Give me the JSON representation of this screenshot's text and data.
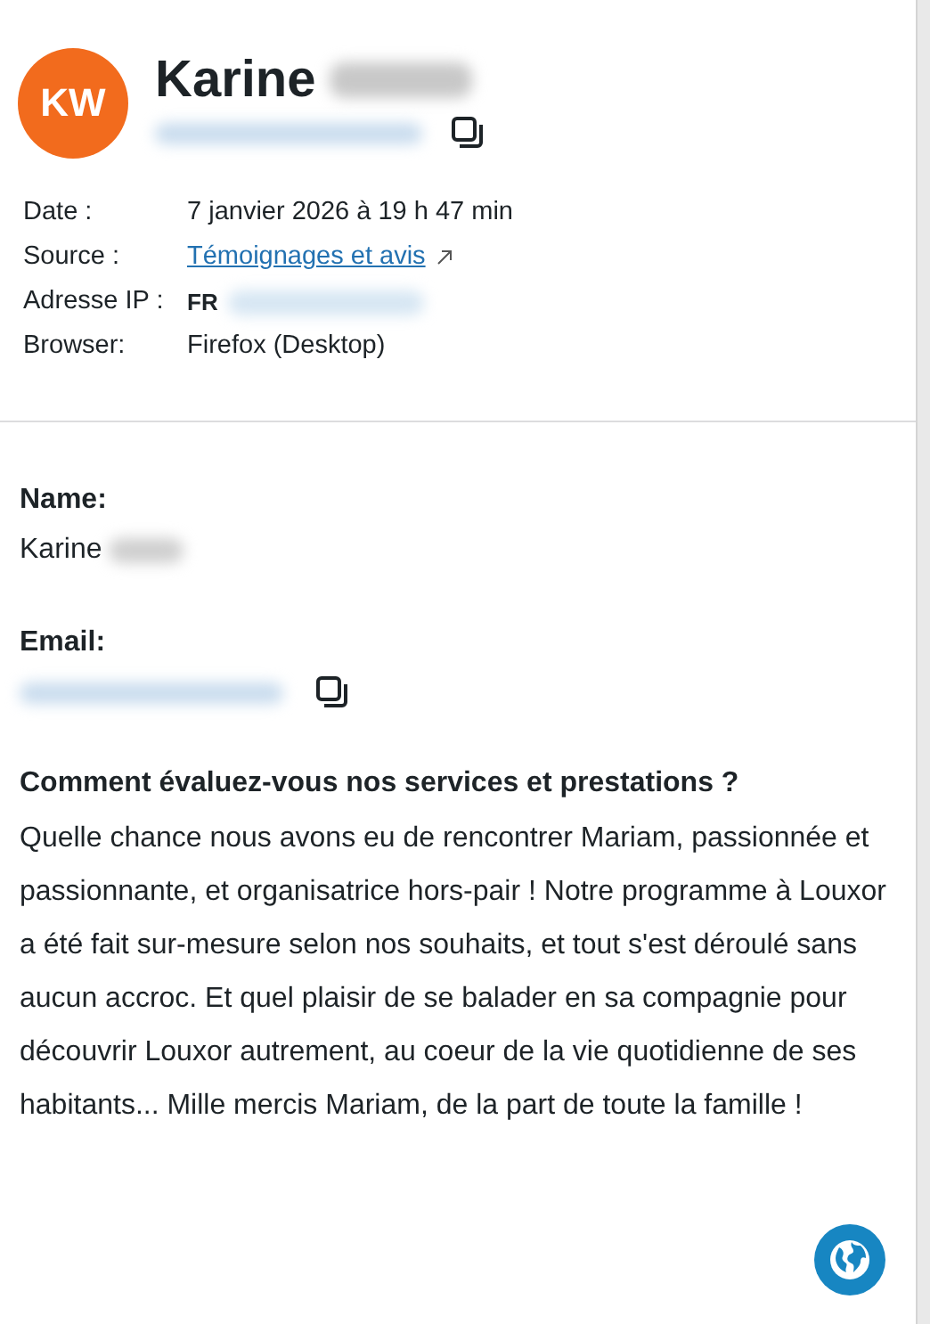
{
  "header": {
    "initials": "KW",
    "name": "Karine"
  },
  "details": [
    {
      "label": "Date :",
      "value": "7 janvier 2026 à 19 h 47 min",
      "kind": "text"
    },
    {
      "label": "Source :",
      "value": "Témoignages et avis",
      "kind": "link"
    },
    {
      "label": "Adresse IP :",
      "value": "FR",
      "kind": "ip"
    },
    {
      "label": "Browser:",
      "value": "Firefox (Desktop)",
      "kind": "text"
    }
  ],
  "fields": [
    {
      "label": "Name:",
      "value": "Karine",
      "kind": "name"
    },
    {
      "label": "Email:",
      "kind": "email"
    },
    {
      "label": "Comment évaluez-vous nos services et prestations ?",
      "value": "Quelle chance nous avons eu de rencontrer Mariam, passionnée et passionnante, et organisatrice hors-pair ! Notre programme à Louxor a été fait sur-mesure selon nos souhaits, et tout s'est déroulé sans aucun accroc. Et quel plaisir de se balader en sa compagnie pour découvrir Louxor autrement, au coeur de la vie quotidienne de ses habitants... Mille mercis Mariam, de la part de toute la famille !",
      "kind": "text"
    }
  ]
}
